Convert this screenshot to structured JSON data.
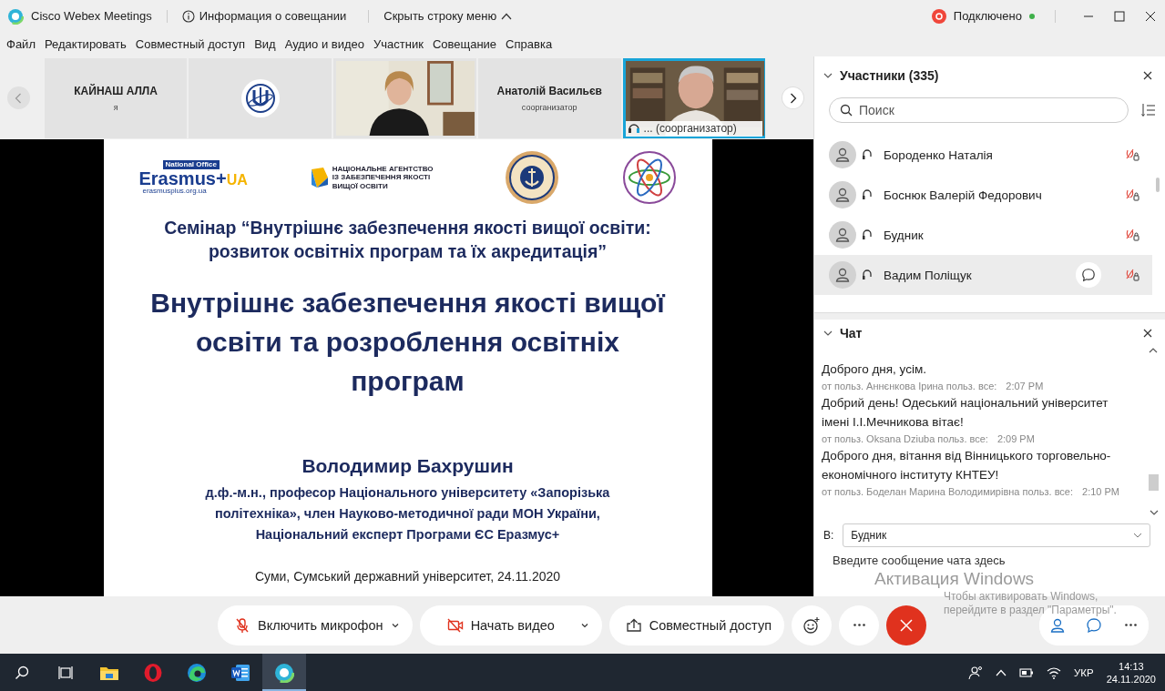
{
  "window": {
    "app_title": "Cisco Webex Meetings",
    "info_button": "Информация о совещании",
    "hide_menu_button": "Скрыть строку меню",
    "status": "Подключено"
  },
  "menu": [
    "Файл",
    "Редактировать",
    "Совместный доступ",
    "Вид",
    "Аудио и видео",
    "Участник",
    "Совещание",
    "Справка"
  ],
  "thumbnails": [
    {
      "kind": "name",
      "name": "КАЙНАШ АЛЛА",
      "role": "я",
      "selected": false
    },
    {
      "kind": "logo",
      "selected": false
    },
    {
      "kind": "video",
      "selected": false
    },
    {
      "kind": "name",
      "name": "Анатолій Васильєв",
      "role": "соорганизатор",
      "selected": false
    },
    {
      "kind": "video",
      "caption": "... (соорганизатор)",
      "selected": true
    }
  ],
  "slide": {
    "logo_office": "National Office",
    "logo_brand": "Erasmus+",
    "logo_country": "UA",
    "logo_site": "erasmusplus.org.ua",
    "agency": "НАЦІОНАЛЬНЕ АГЕНТСТВО ІЗ ЗАБЕЗПЕЧЕННЯ ЯКОСТІ ВИЩОЇ ОСВІТИ",
    "seminar_lines": [
      "Семінар “Внутрішнє забезпечення якості вищої освіти:",
      "розвиток освітніх програм та їх акредитація”"
    ],
    "title_lines": [
      "Внутрішнє забезпечення якості вищої",
      "освіти та розроблення освітніх",
      "програм"
    ],
    "author": "Володимир Бахрушин",
    "details_lines": [
      "д.ф.-м.н., професор Національного університету «Запорізька",
      "політехніка», член Науково-методичної ради МОН України,",
      "Національний експерт Програми ЄС Еразмус+"
    ],
    "footer": "Суми, Сумський державний університет, 24.11.2020"
  },
  "participants": {
    "title": "Участники (335)",
    "search_placeholder": "Поиск",
    "items": [
      {
        "name": "Бороденко Наталія",
        "selected": false
      },
      {
        "name": "Боснюк Валерій Федорович",
        "selected": false
      },
      {
        "name": "Будник",
        "selected": false
      },
      {
        "name": "Вадим Поліщук",
        "selected": true
      }
    ]
  },
  "chat": {
    "title": "Чат",
    "messages": [
      {
        "kind": "text",
        "text": "Доброго дня, усім."
      },
      {
        "kind": "meta",
        "sender": "от польз. Аннєнкова Ірина польз. все:",
        "time": "2:07 PM"
      },
      {
        "kind": "text",
        "text": "Добрий день! Одеський національний університет імені І.І.Мечникова вітає!"
      },
      {
        "kind": "meta",
        "sender": "от польз. Oksana Dziuba польз. все:",
        "time": "2:09 PM"
      },
      {
        "kind": "text",
        "text": "Доброго дня, вітання від Вінницького торговельно-економічного інституту КНТЕУ!"
      },
      {
        "kind": "meta",
        "sender": "от польз. Боделан Марина Володимирівна польз. все:",
        "time": "2:10 PM"
      }
    ],
    "to_label": "В:",
    "recipient": "Будник",
    "placeholder": "Введите сообщение чата здесь"
  },
  "controls": [
    {
      "kind": "mic",
      "label": "Включить микрофон"
    },
    {
      "kind": "video",
      "label": "Начать видео"
    },
    {
      "kind": "share",
      "label": "Совместный доступ"
    },
    {
      "kind": "reactions"
    },
    {
      "kind": "more"
    },
    {
      "kind": "end"
    }
  ],
  "side_controls": [
    {
      "kind": "participants"
    },
    {
      "kind": "chat"
    },
    {
      "kind": "more"
    }
  ],
  "activation": {
    "title": "Активация Windows",
    "text": "Чтобы активировать Windows, перейдите в раздел \"Параметры\"."
  },
  "taskbar": {
    "apps": [
      {
        "kind": "explorer",
        "active": false
      },
      {
        "kind": "opera",
        "active": false
      },
      {
        "kind": "edge",
        "active": false
      },
      {
        "kind": "word",
        "active": false
      },
      {
        "kind": "webex",
        "active": true
      }
    ],
    "language": "УКР",
    "time": "14:13",
    "date": "24.11.2020"
  }
}
